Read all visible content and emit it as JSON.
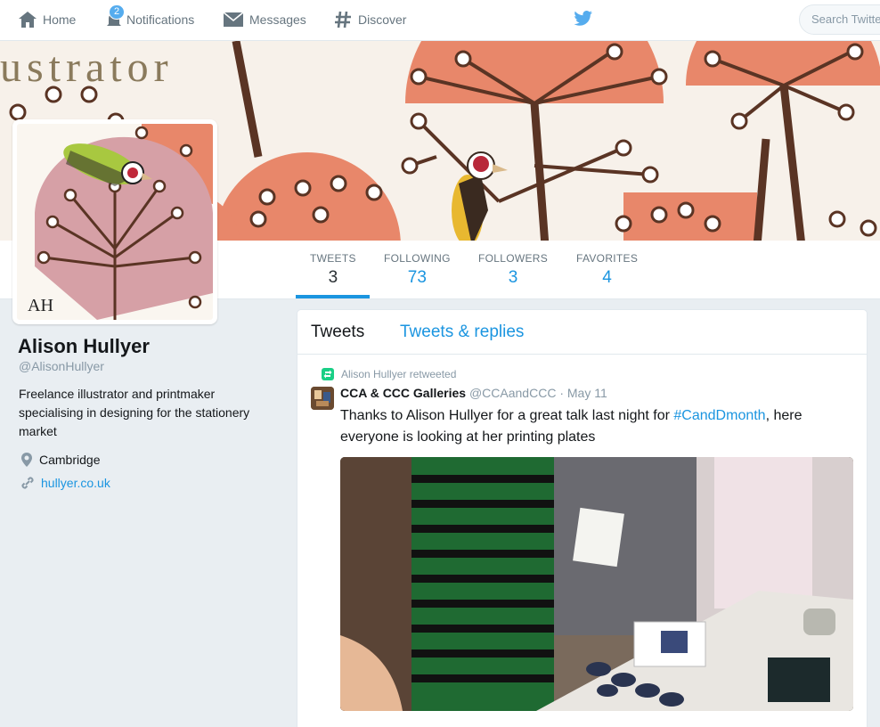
{
  "nav": {
    "home": "Home",
    "notifications": "Notifications",
    "notifications_count": "2",
    "messages": "Messages",
    "discover": "Discover",
    "search_placeholder": "Search Twitter"
  },
  "banner": {
    "word": "ustrator"
  },
  "stats": {
    "tweets": {
      "label": "TWEETS",
      "value": "3"
    },
    "following": {
      "label": "FOLLOWING",
      "value": "73"
    },
    "followers": {
      "label": "FOLLOWERS",
      "value": "3"
    },
    "favorites": {
      "label": "FAVORITES",
      "value": "4"
    }
  },
  "profile": {
    "name": "Alison Hullyer",
    "handle": "@AlisonHullyer",
    "bio": "Freelance illustrator and printmaker specialising in designing for the stationery market",
    "location": "Cambridge",
    "website": "hullyer.co.uk",
    "avatar_initials": "AH"
  },
  "timeline": {
    "tab_tweets": "Tweets",
    "tab_replies": "Tweets & replies",
    "tweet": {
      "retweeted_by": "Alison Hullyer retweeted",
      "author_name": "CCA & CCC Galleries",
      "author_handle": "@CCAandCCC",
      "separator": "·",
      "date": "May 11",
      "text_before": "Thanks to Alison Hullyer for a great talk last night for ",
      "hashtag": "#CandDmonth",
      "text_after": ", here everyone is looking at her printing plates"
    }
  },
  "colors": {
    "accent": "#1b95e0",
    "bird_blue": "#55acee",
    "banner_orange": "#e8876a",
    "banner_brown": "#5a3424"
  }
}
